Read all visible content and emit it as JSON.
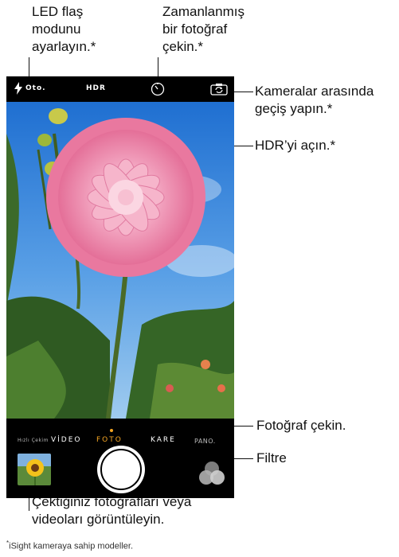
{
  "callouts": {
    "flash": [
      "LED flaş",
      "modunu",
      "ayarlayın.*"
    ],
    "timer": [
      "Zamanlanmış",
      "bir fotoğraf",
      "çekin.*"
    ],
    "switch_camera": [
      "Kameralar arasında",
      "geçiş yapın.*"
    ],
    "hdr": "HDR’yi açın.*",
    "take_photo": "Fotoğraf çekin.",
    "filters": "Filtre",
    "view_photos": [
      "Çektiğiniz fotoğrafları veya",
      "videoları görüntüleyin."
    ]
  },
  "footnote": {
    "mark": "*",
    "text": "iSight kameraya sahip modeller."
  },
  "camera": {
    "flash_mode": "Oto.",
    "hdr_label": "HDR",
    "icons": {
      "flash": "lightning-bolt-icon",
      "timer": "timer-icon",
      "switch_camera": "camera-switch-icon"
    },
    "modes": [
      "Hızlı Çekim",
      "VİDEO",
      "FOTO",
      "KARE",
      "PANO."
    ],
    "active_mode": "FOTO",
    "colors": {
      "active_mode": "#f6a623",
      "bar": "#000000"
    }
  }
}
